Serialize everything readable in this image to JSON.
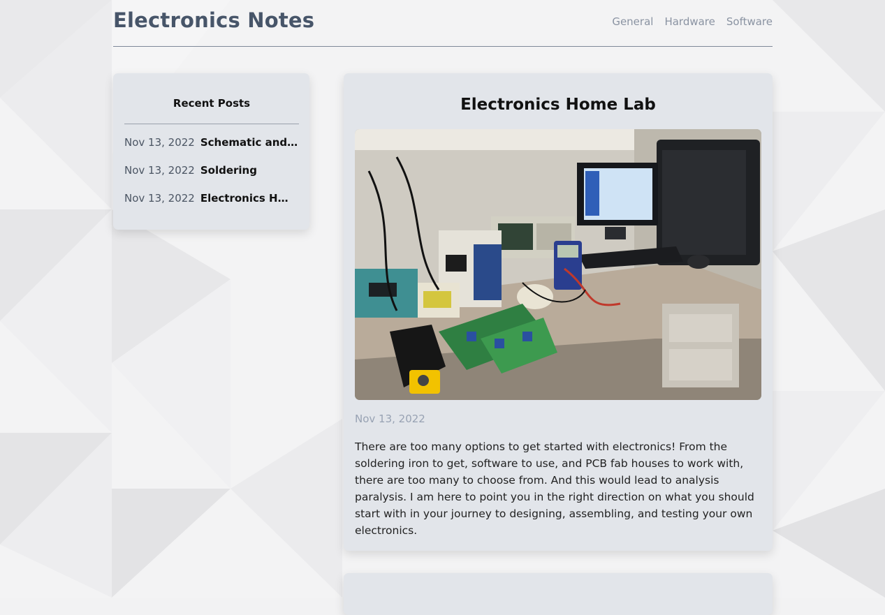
{
  "site": {
    "title": "Electronics Notes"
  },
  "nav": {
    "items": [
      "General",
      "Hardware",
      "Software"
    ]
  },
  "sidebar": {
    "heading": "Recent Posts",
    "posts": [
      {
        "date": "Nov 13, 2022",
        "title": "Schematic and PCB"
      },
      {
        "date": "Nov 13, 2022",
        "title": "Soldering"
      },
      {
        "date": "Nov 13, 2022",
        "title": "Electronics Home Lab"
      }
    ]
  },
  "post": {
    "title": "Electronics Home Lab",
    "image_alt": "electronics workbench photo",
    "date": "Nov 13, 2022",
    "body": "There are too many options to get started with electronics! From the soldering iron to get, software to use, and PCB fab houses to work with, there are too many to choose from. And this would lead to analysis paralysis. I am here to point you in the right direction on what you should start with in your journey to designing, assembling, and testing your own electronics."
  },
  "colors": {
    "title": "#475569",
    "nav": "#8a93a2",
    "card": "#e2e5ea",
    "date_muted": "#98a2b3"
  }
}
